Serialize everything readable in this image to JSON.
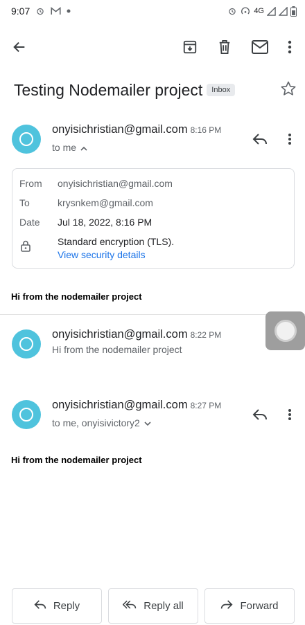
{
  "status_bar": {
    "time": "9:07",
    "network": "4G"
  },
  "toolbar": {
    "back_icon": "arrow-back-icon",
    "archive_icon": "archive-icon",
    "delete_icon": "trash-icon",
    "mark_unread_icon": "mail-icon",
    "more_icon": "more-vert-icon"
  },
  "email": {
    "subject": "Testing Nodemailer project",
    "label": "Inbox"
  },
  "messages": [
    {
      "sender": "onyisichristian@gmail.com",
      "time": "8:16 PM",
      "recipients": "to me"
    },
    {
      "sender": "onyisichristian@gmail.com",
      "time": "8:22 PM",
      "snippet": "Hi from the nodemailer project"
    },
    {
      "sender": "onyisichristian@gmail.com",
      "time": "8:27 PM",
      "recipients": "to me, onyisivictory2"
    }
  ],
  "details": {
    "from_label": "From",
    "from_value": "onyisichristian@gmail.com",
    "to_label": "To",
    "to_value": "krysnkem@gmail.com",
    "date_label": "Date",
    "date_value": "Jul 18, 2022, 8:16 PM",
    "encryption": "Standard encryption (TLS).",
    "security_link": "View security details"
  },
  "bodies": {
    "first": "Hi from the nodemailer project",
    "third": "Hi from the nodemailer project"
  },
  "actions": {
    "reply": "Reply",
    "reply_all": "Reply all",
    "forward": "Forward"
  },
  "colors": {
    "avatar": "#4fc3dd",
    "link": "#1a73e8"
  }
}
